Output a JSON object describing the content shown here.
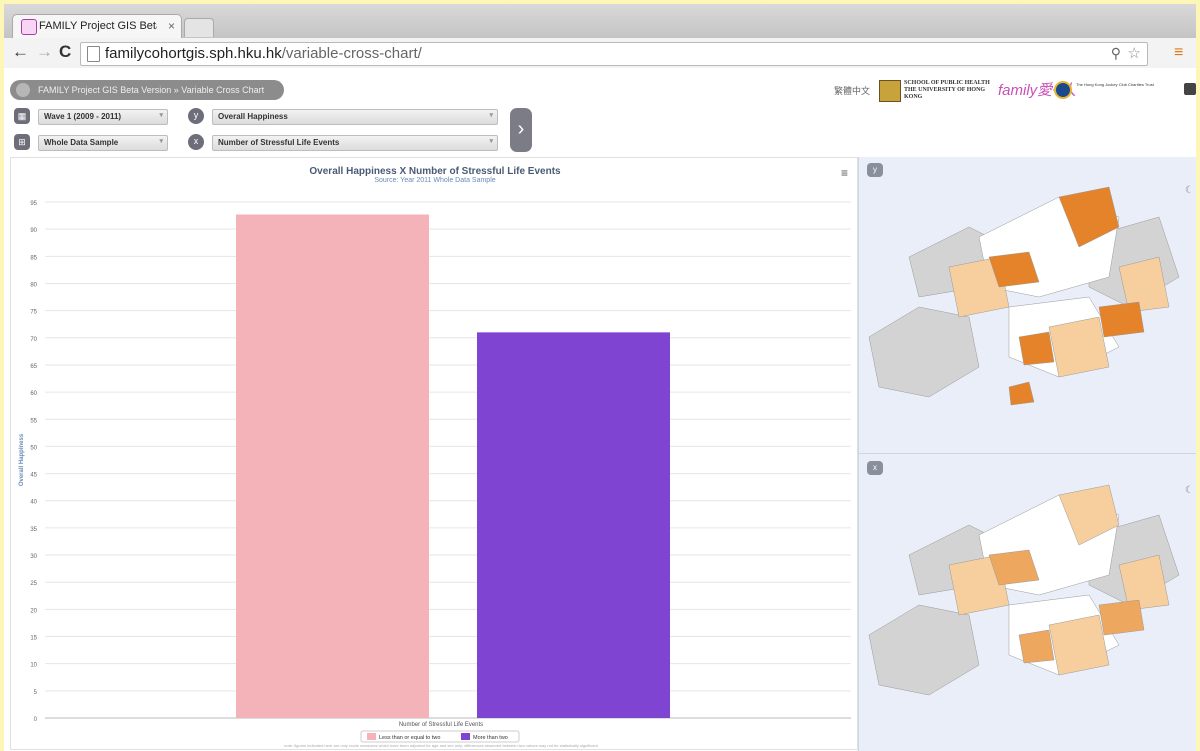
{
  "browser": {
    "tab_title": "FAMILY Project GIS Beta Ve",
    "tab_close": "×",
    "url_host": "familycohortgis.sph.hku.hk",
    "url_path": "/variable-cross-chart/"
  },
  "header": {
    "breadcrumb": "FAMILY Project GIS Beta Version » Variable Cross Chart",
    "language_link": "繁體中文",
    "logo_hku_text": "SCHOOL OF PUBLIC HEALTH THE UNIVERSITY OF HONG KONG",
    "logo_family_text": "family愛+人",
    "logo_jockey_text": "The Hong Kong Jockey Club Charities Trust"
  },
  "controls": {
    "wave": "Wave 1 (2009 - 2011)",
    "sample": "Whole Data Sample",
    "y_label": "y",
    "x_label": "x",
    "y_variable": "Overall Happiness",
    "x_variable": "Number of Stressful Life Events",
    "go_icon": "›"
  },
  "maps": {
    "y_label": "y",
    "x_label": "x"
  },
  "chart_data": {
    "type": "bar",
    "title": "Overall Happiness X Number of Stressful Life Events",
    "subtitle": "Source: Year 2011 Whole Data Sample",
    "xlabel": "Number of Stressful Life Events",
    "ylabel": "Overall Happiness",
    "ylim": [
      0,
      95
    ],
    "yticks": [
      0,
      5,
      10,
      15,
      20,
      25,
      30,
      35,
      40,
      45,
      50,
      55,
      60,
      65,
      70,
      75,
      80,
      85,
      90,
      95
    ],
    "grid": true,
    "legend_position": "bottom",
    "categories": [
      "Less than or equal to two",
      "More than two"
    ],
    "values": [
      92.7,
      71.0
    ],
    "colors": [
      "#f4b2b9",
      "#8044d3"
    ],
    "note": "note: figures indicated here are only crude measures which have been adjusted for age and sex only; differences observed between two values may not be statistically significant"
  }
}
